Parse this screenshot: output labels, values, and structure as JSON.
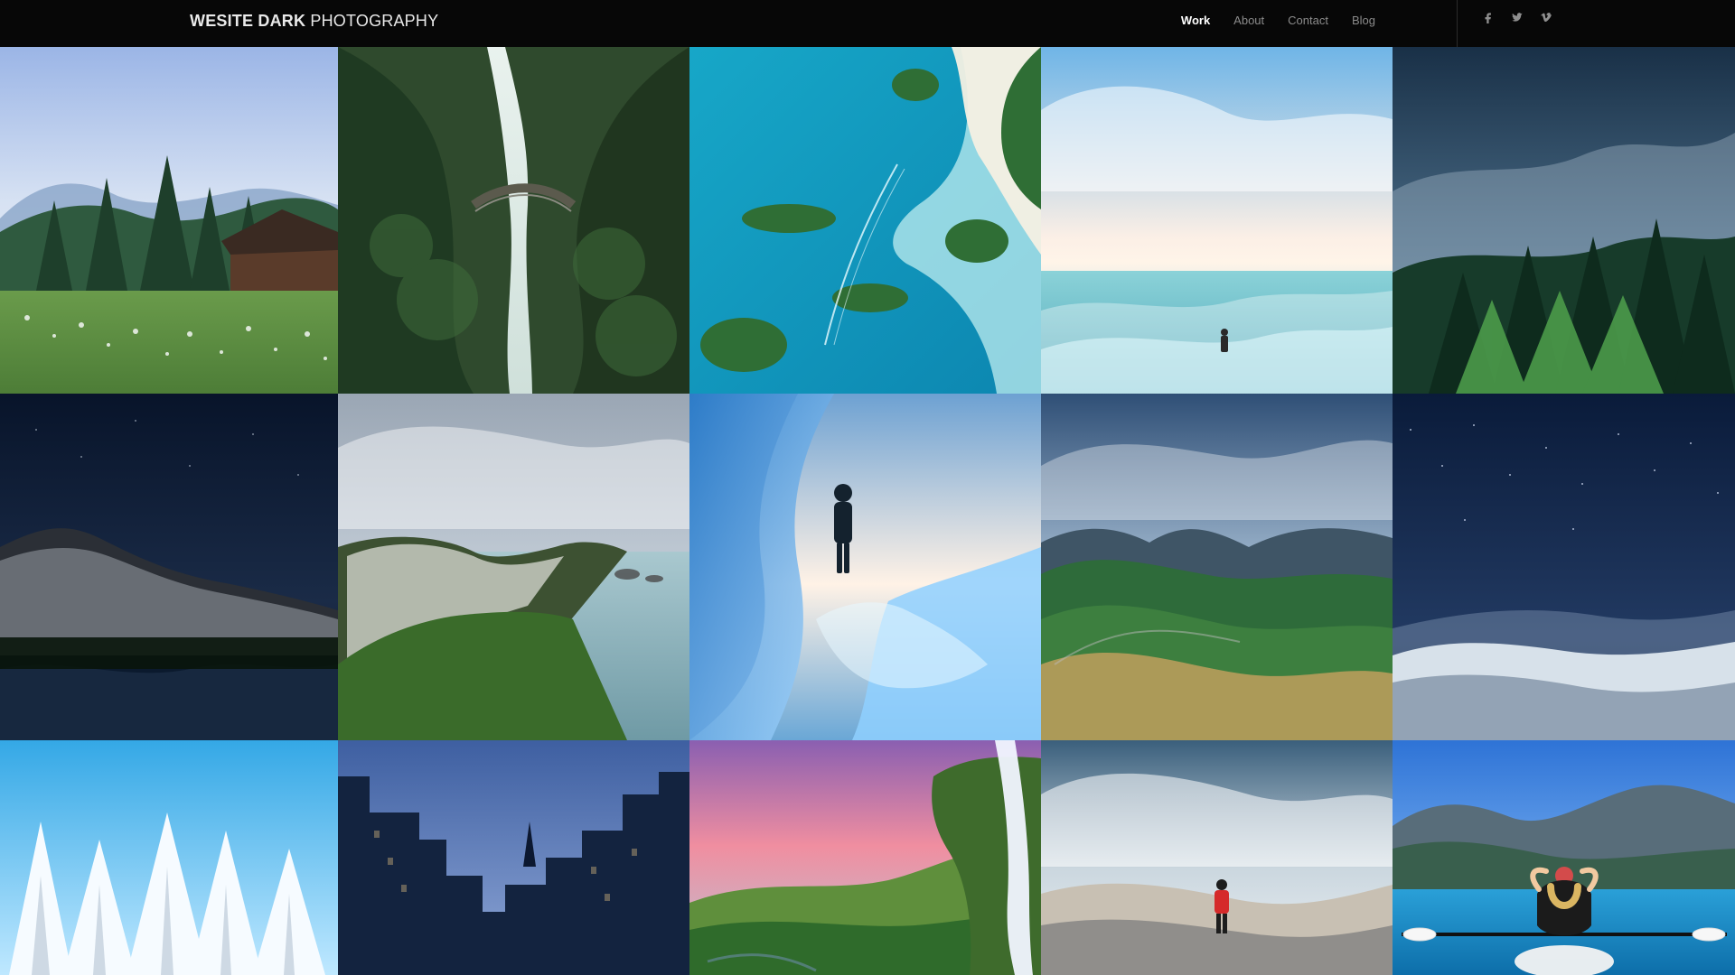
{
  "header": {
    "brand_part1": "WESITE DARK",
    "brand_part2": " PHOTOGRAPHY",
    "nav": [
      {
        "label": "Work",
        "active": true
      },
      {
        "label": "About",
        "active": false
      },
      {
        "label": "Contact",
        "active": false
      },
      {
        "label": "Blog",
        "active": false
      }
    ],
    "social_icons": [
      "facebook-icon",
      "twitter-icon",
      "vimeo-icon"
    ]
  },
  "gallery": {
    "tiles": [
      {
        "subject": "meadow-cabin"
      },
      {
        "subject": "waterfall-bridge"
      },
      {
        "subject": "aerial-islands"
      },
      {
        "subject": "person-in-sea-sunrise"
      },
      {
        "subject": "misty-forest"
      },
      {
        "subject": "night-mountain-lake"
      },
      {
        "subject": "coastal-cliffs"
      },
      {
        "subject": "ice-cave-person"
      },
      {
        "subject": "green-valley-mountains"
      },
      {
        "subject": "starry-sky-snow"
      },
      {
        "subject": "snow-trees"
      },
      {
        "subject": "city-skyline"
      },
      {
        "subject": "sunset-waterfall-cliff"
      },
      {
        "subject": "person-red-jacket-clouds"
      },
      {
        "subject": "kayaker-lake"
      }
    ]
  }
}
